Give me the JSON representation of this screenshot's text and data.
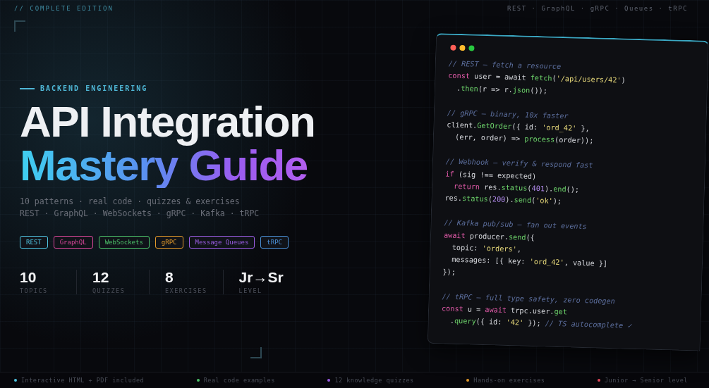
{
  "top_bar": {
    "edition": "// COMPLETE EDITION",
    "topics": "REST · GraphQL · gRPC · Queues · tRPC"
  },
  "hero": {
    "eyebrow": "BACKEND ENGINEERING",
    "title_line_1": "API Integration",
    "title_line_2": "Mastery Guide",
    "subtitle": [
      "10 patterns · real code · quizzes & exercises",
      "REST · GraphQL · WebSockets · gRPC · Kafka · tRPC"
    ],
    "tags": [
      {
        "label": "REST",
        "color": "#4fc3e0"
      },
      {
        "label": "GraphQL",
        "color": "#d9479a"
      },
      {
        "label": "WebSockets",
        "color": "#4cc26a"
      },
      {
        "label": "gRPC",
        "color": "#e39a2b"
      },
      {
        "label": "Message Queues",
        "color": "#9b5de5"
      },
      {
        "label": "tRPC",
        "color": "#4a8fd6"
      }
    ],
    "stats": [
      {
        "value": "10",
        "label": "TOPICS"
      },
      {
        "value": "12",
        "label": "QUIZZES"
      },
      {
        "value": "8",
        "label": "EXERCISES"
      },
      {
        "value": "Jr→Sr",
        "label": "LEVEL"
      }
    ]
  },
  "code_window": {
    "lines": [
      {
        "gap_before": false,
        "tokens": [
          {
            "kind": "comment",
            "text": "// REST — fetch a resource"
          }
        ]
      },
      {
        "gap_before": false,
        "tokens": [
          {
            "kind": "keyword",
            "text": "const"
          },
          {
            "kind": "plain",
            "text": " user = await "
          },
          {
            "kind": "func",
            "text": "fetch"
          },
          {
            "kind": "plain",
            "text": "("
          },
          {
            "kind": "string",
            "text": "'/api/users/42'"
          },
          {
            "kind": "plain",
            "text": ")"
          }
        ]
      },
      {
        "gap_before": false,
        "tokens": [
          {
            "kind": "plain",
            "text": "  ."
          },
          {
            "kind": "func",
            "text": "then"
          },
          {
            "kind": "plain",
            "text": "(r => r."
          },
          {
            "kind": "func",
            "text": "json"
          },
          {
            "kind": "plain",
            "text": "());"
          }
        ]
      },
      {
        "gap_before": true,
        "tokens": [
          {
            "kind": "comment",
            "text": "// gRPC — binary, 10x faster"
          }
        ]
      },
      {
        "gap_before": false,
        "tokens": [
          {
            "kind": "plain",
            "text": "client."
          },
          {
            "kind": "func",
            "text": "GetOrder"
          },
          {
            "kind": "plain",
            "text": "({ id: "
          },
          {
            "kind": "string",
            "text": "'ord_42'"
          },
          {
            "kind": "plain",
            "text": " },"
          }
        ]
      },
      {
        "gap_before": false,
        "tokens": [
          {
            "kind": "plain",
            "text": "  (err, order) => "
          },
          {
            "kind": "func",
            "text": "process"
          },
          {
            "kind": "plain",
            "text": "(order));"
          }
        ]
      },
      {
        "gap_before": true,
        "tokens": [
          {
            "kind": "comment",
            "text": "// Webhook — verify & respond fast"
          }
        ]
      },
      {
        "gap_before": false,
        "tokens": [
          {
            "kind": "keyword",
            "text": "if"
          },
          {
            "kind": "plain",
            "text": " (sig !== expected)"
          }
        ]
      },
      {
        "gap_before": false,
        "tokens": [
          {
            "kind": "keyword",
            "text": "  return"
          },
          {
            "kind": "plain",
            "text": " res."
          },
          {
            "kind": "func",
            "text": "status"
          },
          {
            "kind": "plain",
            "text": "("
          },
          {
            "kind": "number",
            "text": "401"
          },
          {
            "kind": "plain",
            "text": ")."
          },
          {
            "kind": "func",
            "text": "end"
          },
          {
            "kind": "plain",
            "text": "();"
          }
        ]
      },
      {
        "gap_before": false,
        "tokens": [
          {
            "kind": "plain",
            "text": "res."
          },
          {
            "kind": "func",
            "text": "status"
          },
          {
            "kind": "plain",
            "text": "("
          },
          {
            "kind": "number",
            "text": "200"
          },
          {
            "kind": "plain",
            "text": ")."
          },
          {
            "kind": "func",
            "text": "send"
          },
          {
            "kind": "plain",
            "text": "("
          },
          {
            "kind": "string",
            "text": "'ok'"
          },
          {
            "kind": "plain",
            "text": ");"
          }
        ]
      },
      {
        "gap_before": true,
        "tokens": [
          {
            "kind": "comment",
            "text": "// Kafka pub/sub — fan out events"
          }
        ]
      },
      {
        "gap_before": false,
        "tokens": [
          {
            "kind": "keyword",
            "text": "await"
          },
          {
            "kind": "plain",
            "text": " producer."
          },
          {
            "kind": "func",
            "text": "send"
          },
          {
            "kind": "plain",
            "text": "({"
          }
        ]
      },
      {
        "gap_before": false,
        "tokens": [
          {
            "kind": "plain",
            "text": "  topic: "
          },
          {
            "kind": "string",
            "text": "'orders'"
          },
          {
            "kind": "plain",
            "text": ","
          }
        ]
      },
      {
        "gap_before": false,
        "tokens": [
          {
            "kind": "plain",
            "text": "  messages: [{ key: "
          },
          {
            "kind": "string",
            "text": "'ord_42'"
          },
          {
            "kind": "plain",
            "text": ", value }]"
          }
        ]
      },
      {
        "gap_before": false,
        "tokens": [
          {
            "kind": "plain",
            "text": "});"
          }
        ]
      },
      {
        "gap_before": true,
        "tokens": [
          {
            "kind": "comment",
            "text": "// tRPC — full type safety, zero codegen"
          }
        ]
      },
      {
        "gap_before": false,
        "tokens": [
          {
            "kind": "keyword",
            "text": "const"
          },
          {
            "kind": "plain",
            "text": " u = "
          },
          {
            "kind": "keyword",
            "text": "await"
          },
          {
            "kind": "plain",
            "text": " trpc.user."
          },
          {
            "kind": "func",
            "text": "get"
          }
        ]
      },
      {
        "gap_before": false,
        "tokens": [
          {
            "kind": "plain",
            "text": "  ."
          },
          {
            "kind": "func",
            "text": "query"
          },
          {
            "kind": "plain",
            "text": "({ id: "
          },
          {
            "kind": "string",
            "text": "'42'"
          },
          {
            "kind": "plain",
            "text": " }); "
          },
          {
            "kind": "comment",
            "text": "// TS autocomplete ✓"
          }
        ]
      }
    ]
  },
  "footer": [
    {
      "label": "Interactive HTML + PDF included",
      "color": "#4fc3e0"
    },
    {
      "label": "Real code examples",
      "color": "#4cc26a"
    },
    {
      "label": "12 knowledge quizzes",
      "color": "#9b5de5"
    },
    {
      "label": "Hands-on exercises",
      "color": "#e39a2b"
    },
    {
      "label": "Junior → Senior level",
      "color": "#e0475a"
    }
  ]
}
